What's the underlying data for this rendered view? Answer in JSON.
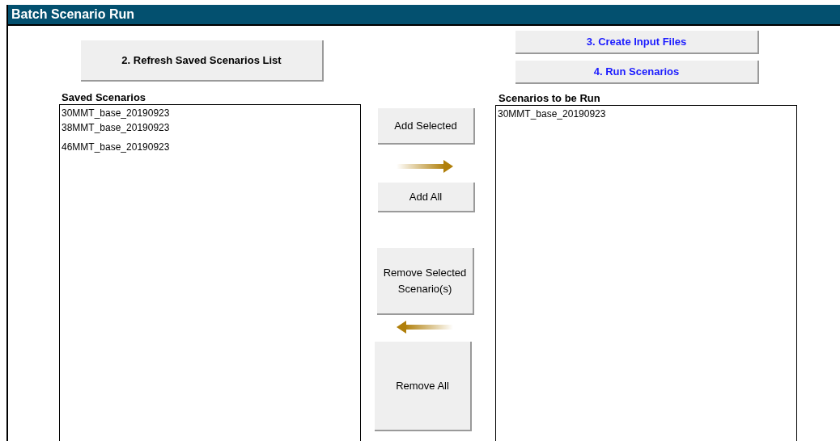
{
  "window": {
    "title": "Batch Scenario Run"
  },
  "refresh_button": {
    "label": "2. Refresh Saved Scenarios List"
  },
  "step_buttons": [
    {
      "label": "3. Create Input Files",
      "kind": "link"
    },
    {
      "label": "4. Run Scenarios",
      "kind": "link"
    }
  ],
  "saved_scenarios": {
    "label": "Saved Scenarios",
    "items": [
      "30MMT_base_20190923",
      "38MMT_base_20190923",
      "46MMT_base_20190923"
    ]
  },
  "transfer_buttons": [
    {
      "label": "Add Selected"
    },
    {
      "label": "Add All"
    },
    {
      "label": "Remove Selected Scenario(s)"
    },
    {
      "label": "Remove All"
    }
  ],
  "scenarios_to_run": {
    "label": "Scenarios to be Run",
    "items": [
      "30MMT_base_20190923"
    ]
  }
}
